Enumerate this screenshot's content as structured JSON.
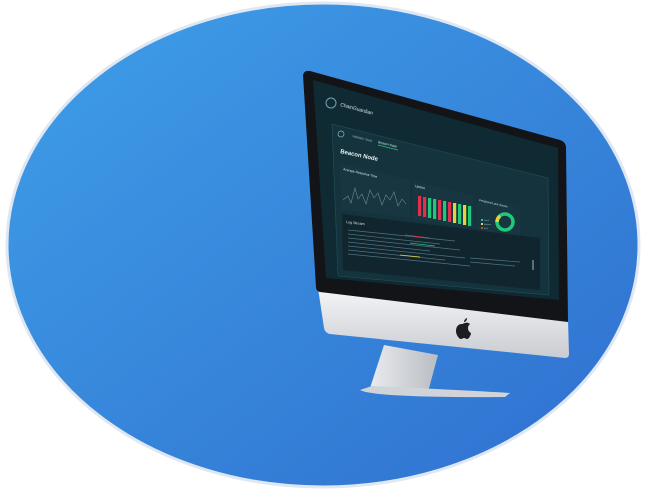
{
  "app": {
    "name": "ChainGuardian",
    "logo_icon": "chainguardian-logo-icon"
  },
  "nav": {
    "back_icon": "back-arrow-icon",
    "tabs": [
      {
        "label": "Validator Stats",
        "active": false
      },
      {
        "label": "Beacon Node",
        "active": true
      }
    ]
  },
  "page": {
    "title": "Beacon Node"
  },
  "cards": {
    "response_time": {
      "title": "Average Response Time"
    },
    "uptime": {
      "title": "Uptime"
    },
    "peers": {
      "title": "Peripheral Lane Scores",
      "legend": [
        "Good",
        "Medium",
        "Bad"
      ]
    },
    "logs": {
      "title": "Log Stream"
    }
  },
  "colors": {
    "background_circle": "#3a8fe0",
    "screen_bg": "#0f2a33",
    "card_bg": "#17363f",
    "accent_green": "#1ec97b",
    "accent_red": "#e0304e",
    "accent_yellow": "#e8d23a",
    "device_silver": "#d6d8dc"
  },
  "device": {
    "brand_icon": "apple-logo-icon"
  }
}
